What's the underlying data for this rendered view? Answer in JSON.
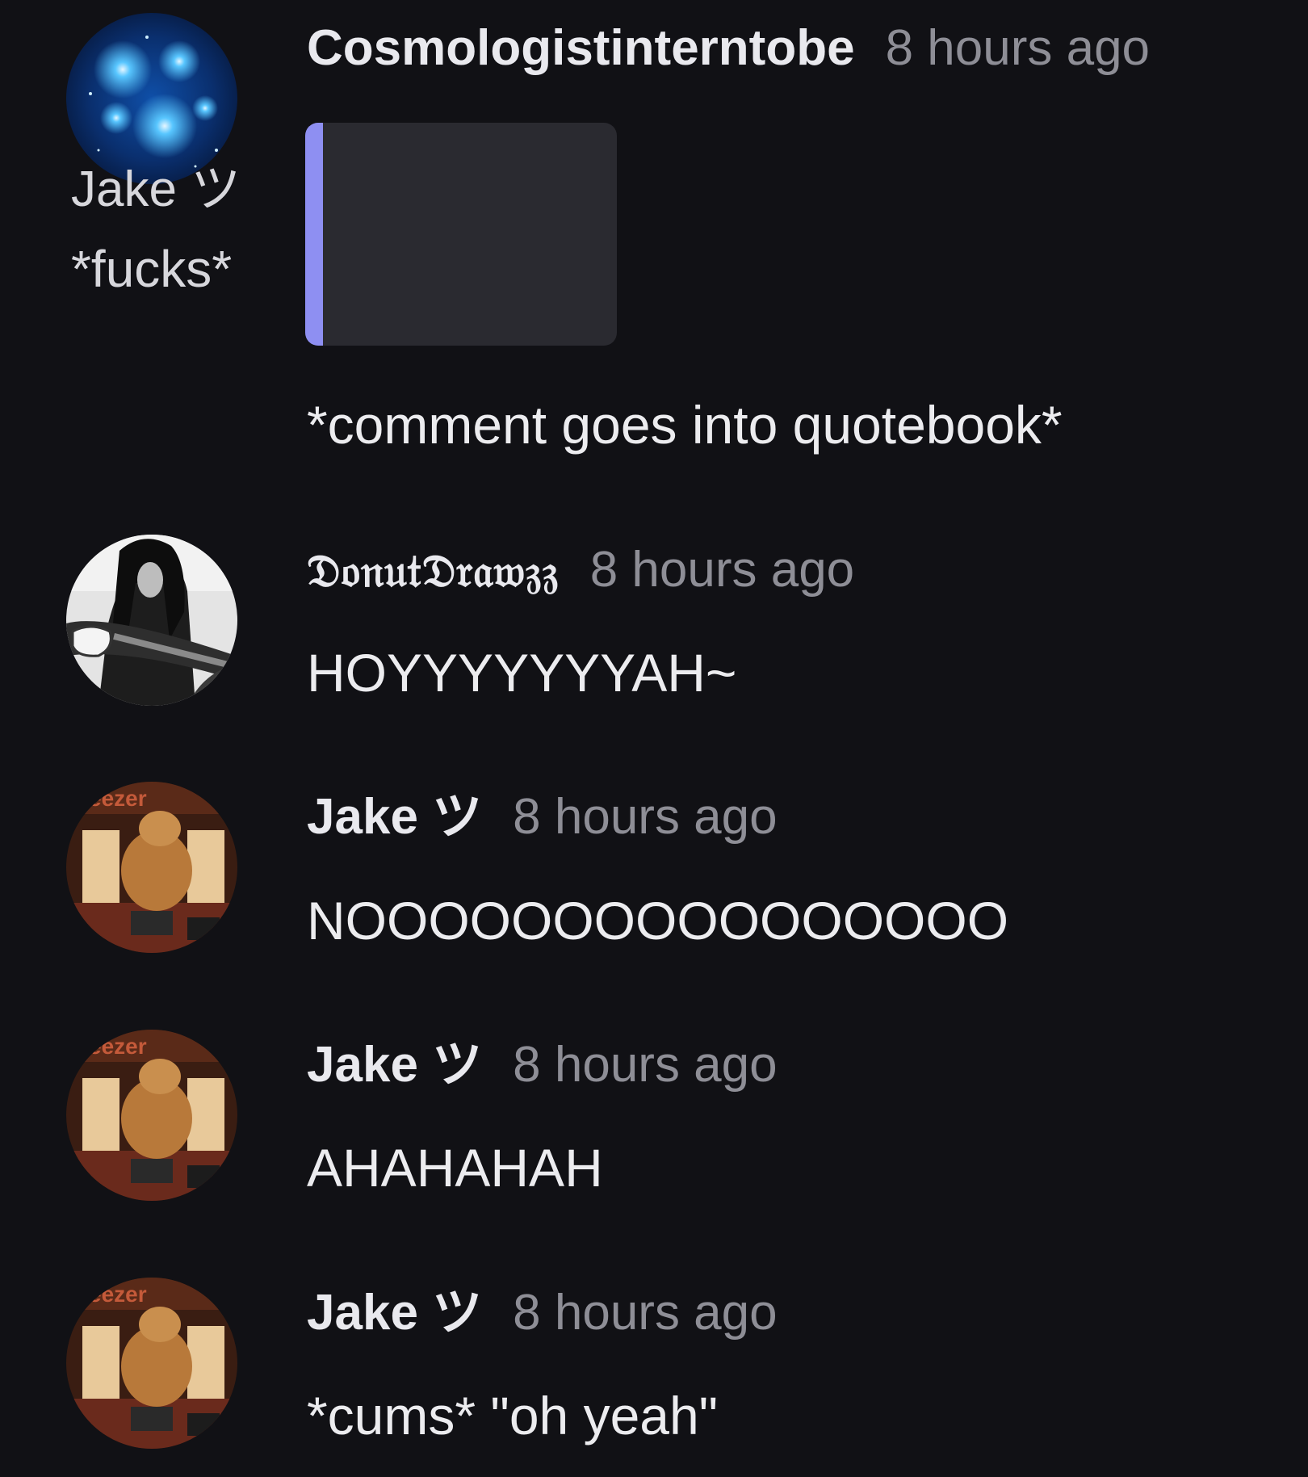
{
  "comments": [
    {
      "avatar": "starfield-avatar",
      "username": "Cosmologistinterntobe",
      "time": "8 hours ago",
      "quote": {
        "author": "Jake ツ",
        "text": "*fucks*"
      },
      "text": "*comment goes into quotebook*"
    },
    {
      "avatar": "guitarist-avatar",
      "username": "𝔇𝔬𝔫𝔲𝔱𝔇𝔯𝔞𝔴𝔷𝔷",
      "time": "8 hours ago",
      "text": "HOYYYYYYYAH~"
    },
    {
      "avatar": "dog-avatar",
      "username": "Jake ツ",
      "time": "8 hours ago",
      "text": "NOOOOOOOOOOOOOOOO"
    },
    {
      "avatar": "dog-avatar",
      "username": "Jake ツ",
      "time": "8 hours ago",
      "text": "AHAHAHAH"
    },
    {
      "avatar": "dog-avatar",
      "username": "Jake ツ",
      "time": "8 hours ago",
      "text": "*cums* \"oh yeah\""
    }
  ],
  "colors": {
    "background": "#111115",
    "quote_bar": "#8e8ff2",
    "quote_bg": "#2a2a30",
    "timestamp": "#8e8ff2"
  }
}
